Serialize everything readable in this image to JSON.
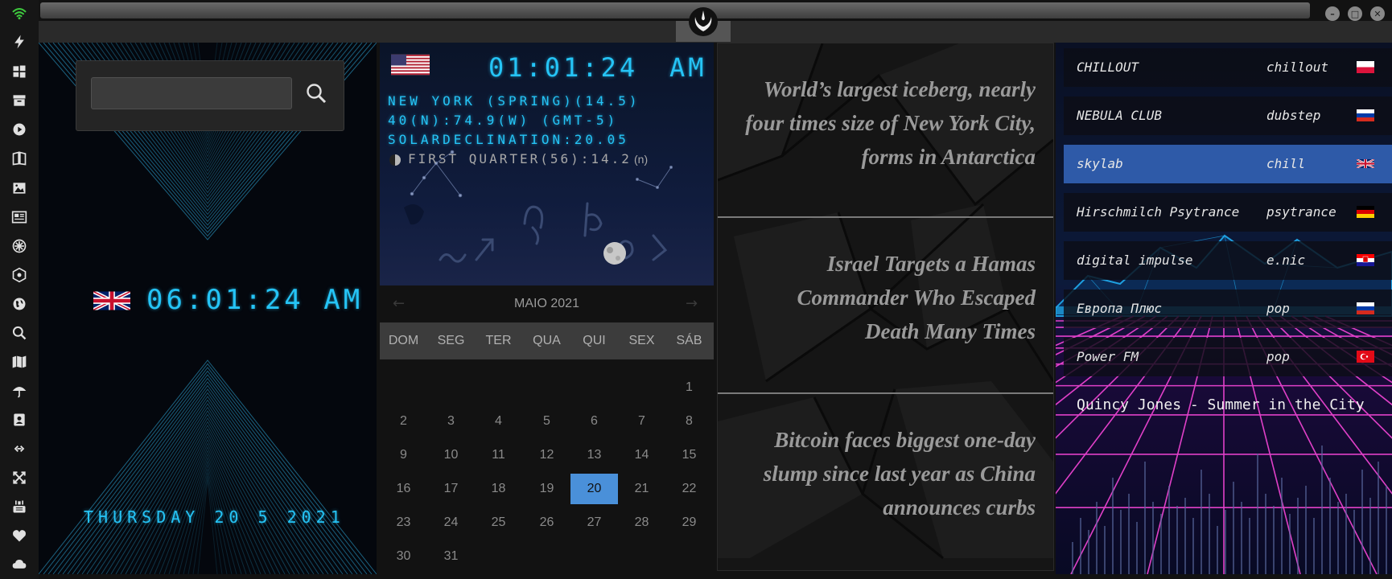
{
  "sidebar": {
    "icons": [
      "wifi-icon",
      "bolt-icon",
      "windows-icon",
      "archive-icon",
      "play-icon",
      "book-icon",
      "image-icon",
      "newspaper-icon",
      "crosshair-icon",
      "hexagon-icon",
      "globe-icon",
      "search-icon",
      "map-icon",
      "umbrella-icon",
      "contacts-icon",
      "link-icon",
      "expand-icon",
      "youtube-icon",
      "heart-icon",
      "cloud-icon"
    ],
    "accent_color": "#3ec93e"
  },
  "clock_uk": {
    "time": "06:01:24 AM",
    "date": "THURSDAY 20 5 2021",
    "flag": "uk-flag-icon"
  },
  "search": {
    "placeholder": "",
    "value": ""
  },
  "clock_ny": {
    "time": "01:01:24",
    "ampm": "AM",
    "flag": "us-flag-icon",
    "location": "NEW YORK (SPRING)(14.5)",
    "coords": "40(N):74.9(W) (GMT-5)",
    "solar": "SOLARDECLINATION:20.05",
    "moon": "FIRST QUARTER(56):14.2",
    "moon_suffix": "(n)"
  },
  "calendar": {
    "month_label": "MAIO 2021",
    "prev": "←",
    "next": "→",
    "weekdays": [
      "DOM",
      "SEG",
      "TER",
      "QUA",
      "QUI",
      "SEX",
      "SÁB"
    ],
    "weeks": [
      [
        "",
        "",
        "",
        "",
        "",
        "",
        "1"
      ],
      [
        "2",
        "3",
        "4",
        "5",
        "6",
        "7",
        "8"
      ],
      [
        "9",
        "10",
        "11",
        "12",
        "13",
        "14",
        "15"
      ],
      [
        "16",
        "17",
        "18",
        "19",
        "20",
        "21",
        "22"
      ],
      [
        "23",
        "24",
        "25",
        "26",
        "27",
        "28",
        "29"
      ],
      [
        "30",
        "31",
        "",
        "",
        "",
        "",
        ""
      ]
    ],
    "selected_day": "20",
    "selected_color": "#4a90d9"
  },
  "news": [
    {
      "lines": [
        "World’s largest iceberg, nearly",
        "four times size of New York City,",
        "forms in Antarctica"
      ]
    },
    {
      "lines": [
        "Israel Targets a Hamas",
        "Commander Who Escaped",
        "Death Many Times"
      ]
    },
    {
      "lines": [
        "Bitcoin faces biggest one-day",
        "slump since last year as China",
        "announces curbs"
      ]
    }
  ],
  "radio": {
    "stations": [
      {
        "name": "CHILLOUT",
        "genre": "chillout",
        "flag": "poland-flag-icon"
      },
      {
        "name": "NEBULA CLUB",
        "genre": "dubstep",
        "flag": "russia-flag-icon"
      },
      {
        "name": "skylab",
        "genre": "chill",
        "flag": "uk-flag-icon"
      },
      {
        "name": "Hirschmilch Psytrance",
        "genre": "psytrance",
        "flag": "germany-flag-icon"
      },
      {
        "name": "digital impulse",
        "genre": "e.nic",
        "flag": "croatia-flag-icon"
      },
      {
        "name": "Европа Плюс",
        "genre": "pop",
        "flag": "russia-flag-icon"
      },
      {
        "name": "Power FM",
        "genre": "pop",
        "flag": "turkey-flag-icon"
      }
    ],
    "selected_index": 2,
    "selected_color": "#2e5aa8",
    "now_playing": "Quincy Jones - Summer in the City",
    "grid_color": "#e040c8",
    "mountain_color": "#1e9fe0"
  }
}
